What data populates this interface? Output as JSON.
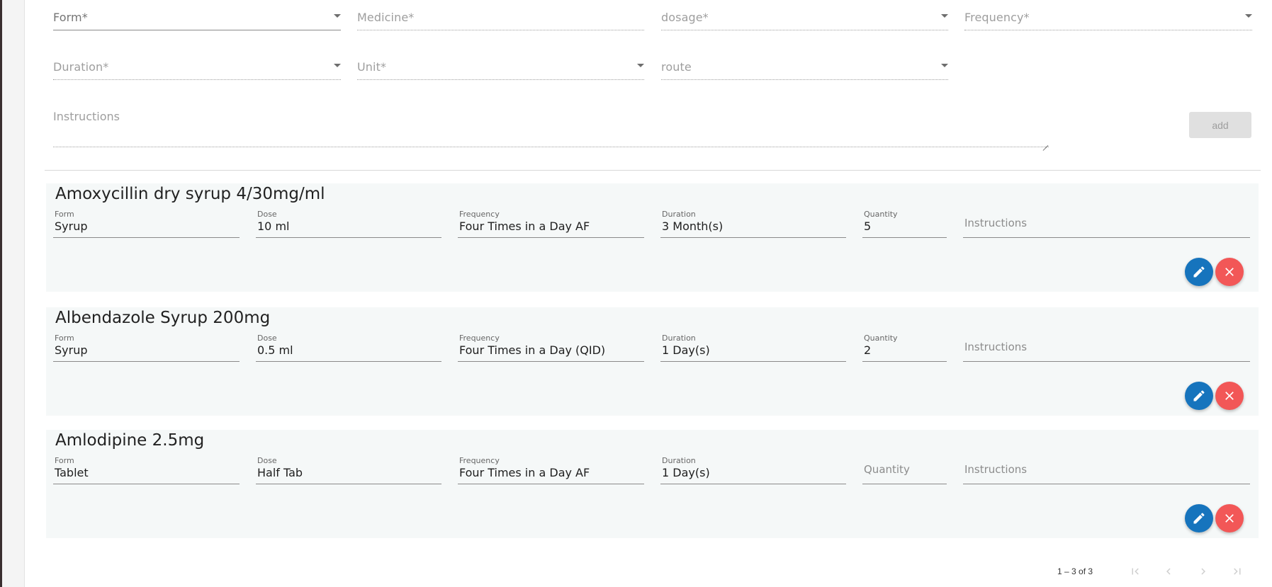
{
  "form": {
    "fields": {
      "form": "Form*",
      "medicine": "Medicine*",
      "dosage": "dosage*",
      "frequency": "Frequency*",
      "duration": "Duration*",
      "unit": "Unit*",
      "route": "route",
      "instructions": "Instructions"
    },
    "add_label": "add"
  },
  "card_labels": {
    "form": "Form",
    "dose": "Dose",
    "frequency": "Frequency",
    "duration": "Duration",
    "quantity": "Quantity",
    "instructions": "Instructions"
  },
  "prescriptions": [
    {
      "name": "Amoxycillin dry syrup 4/30mg/ml",
      "form": "Syrup",
      "dose": "10 ml",
      "frequency": "Four Times in a Day AF",
      "duration": "3 Month(s)",
      "quantity": "5",
      "instructions": ""
    },
    {
      "name": "Albendazole Syrup 200mg",
      "form": "Syrup",
      "dose": "0.5 ml",
      "frequency": "Four Times in a Day (QID)",
      "duration": "1 Day(s)",
      "quantity": "2",
      "instructions": ""
    },
    {
      "name": "Amlodipine 2.5mg",
      "form": "Tablet",
      "dose": "Half Tab",
      "frequency": "Four Times in a Day AF",
      "duration": "1 Day(s)",
      "quantity": "",
      "instructions": ""
    }
  ],
  "paginator": {
    "range_label": "1 – 3 of 3"
  },
  "icons": {
    "edit": "pencil-icon",
    "delete": "close-icon",
    "first": "first-page-icon",
    "prev": "chevron-left-icon",
    "next": "chevron-right-icon",
    "last": "last-page-icon"
  },
  "colors": {
    "edit": "#1674bd",
    "delete": "#f25757",
    "card_bg": "#f5f8f8"
  }
}
